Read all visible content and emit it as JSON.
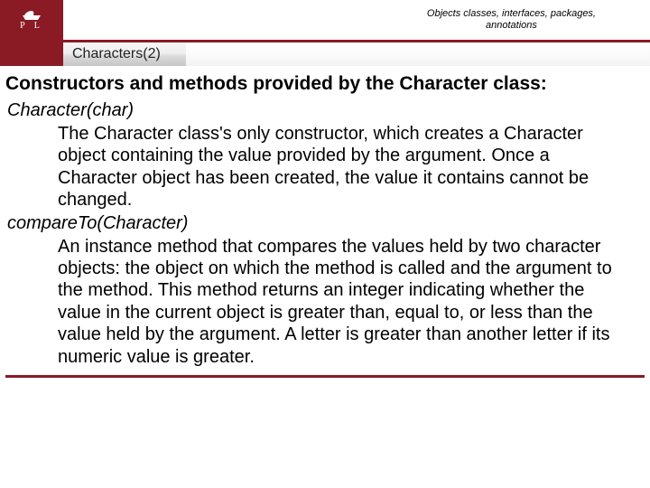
{
  "header": {
    "logo_letters": "P   L",
    "breadcrumb_line1": "Objects classes, interfaces, packages,",
    "breadcrumb_line2": "annotations"
  },
  "subbar": {
    "title": "Characters(2)"
  },
  "content": {
    "heading": "Constructors and methods provided by the Character class:",
    "items": [
      {
        "signature": "Character(char)",
        "description": "The Character class's only constructor, which creates a Character object containing the value provided by the argument. Once a Character object has been created, the value it contains cannot be changed."
      },
      {
        "signature": "compareTo(Character)",
        "description": "An instance method that compares the values held by two character objects: the object on which the method is called and the argument to the method. This method returns an integer indicating whether the value in the current object is greater than, equal to, or less than the value held by the argument. A letter is greater than another letter if its numeric value is greater."
      }
    ]
  }
}
